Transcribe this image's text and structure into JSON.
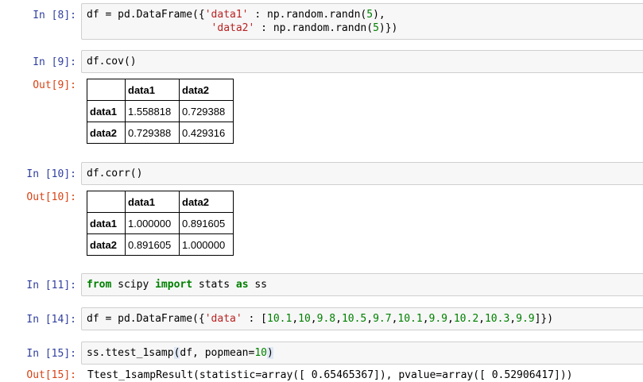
{
  "cells": [
    {
      "in_prompt": "In [8]:",
      "code_lines": [
        [
          {
            "t": "df = pd.DataFrame({",
            "c": ""
          },
          {
            "t": "'data1'",
            "c": "str"
          },
          {
            "t": " : np.random.randn(",
            "c": ""
          },
          {
            "t": "5",
            "c": "num"
          },
          {
            "t": "),",
            "c": ""
          }
        ],
        [
          {
            "t": "                    ",
            "c": ""
          },
          {
            "t": "'data2'",
            "c": "str"
          },
          {
            "t": " : np.random.randn(",
            "c": ""
          },
          {
            "t": "5",
            "c": "num"
          },
          {
            "t": ")})",
            "c": ""
          }
        ]
      ]
    },
    {
      "in_prompt": "In [9]:",
      "code_lines": [
        [
          {
            "t": "df.cov()",
            "c": ""
          }
        ]
      ],
      "out_prompt": "Out[9]:",
      "table": {
        "columns": [
          "",
          "data1",
          "data2"
        ],
        "rows": [
          [
            "data1",
            "1.558818",
            "0.729388"
          ],
          [
            "data2",
            "0.729388",
            "0.429316"
          ]
        ]
      }
    },
    {
      "in_prompt": "In [10]:",
      "code_lines": [
        [
          {
            "t": "df.corr()",
            "c": ""
          }
        ]
      ],
      "out_prompt": "Out[10]:",
      "table": {
        "columns": [
          "",
          "data1",
          "data2"
        ],
        "rows": [
          [
            "data1",
            "1.000000",
            "0.891605"
          ],
          [
            "data2",
            "0.891605",
            "1.000000"
          ]
        ]
      }
    },
    {
      "in_prompt": "In [11]:",
      "code_lines": [
        [
          {
            "t": "from",
            "c": "kw"
          },
          {
            "t": " scipy ",
            "c": ""
          },
          {
            "t": "import",
            "c": "kw"
          },
          {
            "t": " stats ",
            "c": ""
          },
          {
            "t": "as",
            "c": "kw"
          },
          {
            "t": " ss",
            "c": ""
          }
        ]
      ]
    },
    {
      "in_prompt": "In [14]:",
      "code_lines": [
        [
          {
            "t": "df = pd.DataFrame({",
            "c": ""
          },
          {
            "t": "'data'",
            "c": "str"
          },
          {
            "t": " : [",
            "c": ""
          },
          {
            "t": "10.1",
            "c": "num"
          },
          {
            "t": ",",
            "c": ""
          },
          {
            "t": "10",
            "c": "num"
          },
          {
            "t": ",",
            "c": ""
          },
          {
            "t": "9.8",
            "c": "num"
          },
          {
            "t": ",",
            "c": ""
          },
          {
            "t": "10.5",
            "c": "num"
          },
          {
            "t": ",",
            "c": ""
          },
          {
            "t": "9.7",
            "c": "num"
          },
          {
            "t": ",",
            "c": ""
          },
          {
            "t": "10.1",
            "c": "num"
          },
          {
            "t": ",",
            "c": ""
          },
          {
            "t": "9.9",
            "c": "num"
          },
          {
            "t": ",",
            "c": ""
          },
          {
            "t": "10.2",
            "c": "num"
          },
          {
            "t": ",",
            "c": ""
          },
          {
            "t": "10.3",
            "c": "num"
          },
          {
            "t": ",",
            "c": ""
          },
          {
            "t": "9.9",
            "c": "num"
          },
          {
            "t": "]})",
            "c": ""
          }
        ]
      ]
    },
    {
      "in_prompt": "In [15]:",
      "code_lines": [
        [
          {
            "t": "ss.ttest_1samp",
            "c": ""
          },
          {
            "t": "(",
            "c": "hl"
          },
          {
            "t": "df, popmean=",
            "c": ""
          },
          {
            "t": "10",
            "c": "num"
          },
          {
            "t": ")",
            "c": "hl"
          }
        ]
      ],
      "out_prompt": "Out[15]:",
      "output_text": "Ttest_1sampResult(statistic=array([ 0.65465367]), pvalue=array([ 0.52906417]))"
    }
  ],
  "colors": {
    "in_prompt": "#303f9f",
    "out_prompt": "#d84315",
    "keyword": "#008000",
    "string": "#ba2121",
    "number": "#008000",
    "cell_bg": "#f7f7f7",
    "cell_border": "#cfcfcf"
  }
}
